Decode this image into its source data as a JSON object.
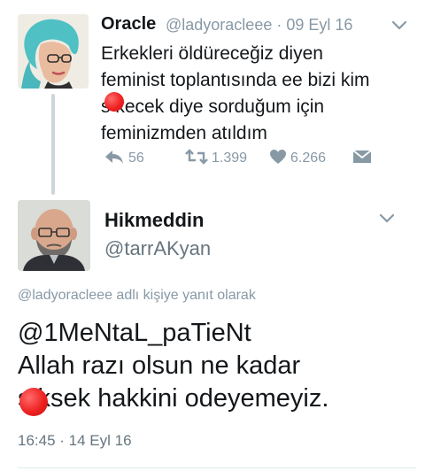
{
  "tweet1": {
    "display_name": "Oracle",
    "handle": "@ladyoracleee",
    "date": "· 09 Eyl 16",
    "text_lines": [
      "Erkekleri öldüreceğiz diyen",
      "feminist toplantısında ee bizi kim",
      "s  kecek diye sorduğum için",
      "feminizmden atıldım"
    ],
    "reply_count": "56",
    "retweet_count": "1.399",
    "like_count": "6.266"
  },
  "tweet2": {
    "display_name": "Hikmeddin",
    "handle": "@tarrAKyan",
    "reply_to_handle": "@ladyoracleee",
    "reply_to_suffix": "adlı kişiye yanıt olarak",
    "text_lines": [
      "@1MeNtaL_paTieNt",
      "Allah razı olsun ne kadar",
      "s  ksek hakkini odeyemeyiz."
    ],
    "timestamp": "16:45 · 14 Eyl 16"
  },
  "icons": {
    "reply": "reply-icon",
    "retweet": "retweet-icon",
    "like": "heart-icon",
    "dm": "envelope-icon",
    "menu": "chevron-down-icon"
  },
  "colors": {
    "muted": "#8899a6",
    "text": "#14171a",
    "thread_line": "#ccd6dd",
    "redaction": "#ee2222"
  }
}
